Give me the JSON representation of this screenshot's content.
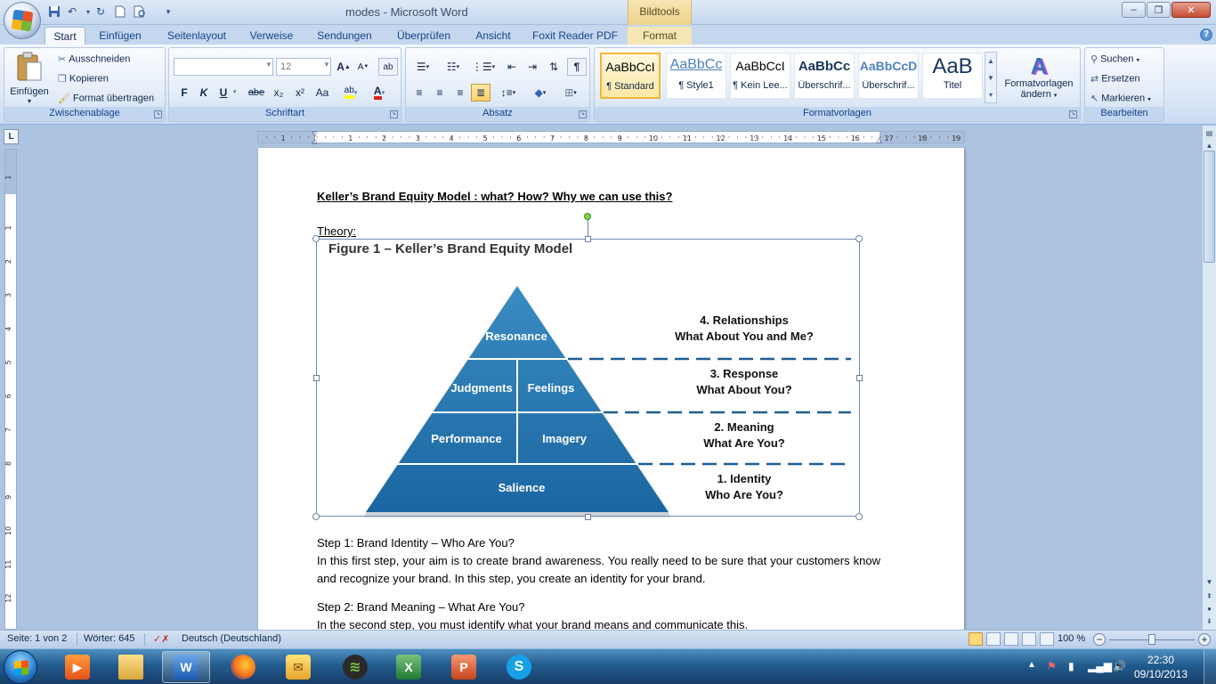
{
  "window": {
    "title": "modes - Microsoft Word",
    "context_tab": "Bildtools",
    "controls": {
      "minimize": "–",
      "maximize": "❐",
      "close": "✕"
    }
  },
  "quick_access": [
    "save-icon",
    "undo-icon",
    "redo-icon",
    "new-document-icon",
    "print-preview-icon"
  ],
  "tabs": [
    {
      "label": "Start",
      "active": true
    },
    {
      "label": "Einfügen"
    },
    {
      "label": "Seitenlayout"
    },
    {
      "label": "Verweise"
    },
    {
      "label": "Sendungen"
    },
    {
      "label": "Überprüfen"
    },
    {
      "label": "Ansicht"
    },
    {
      "label": "Foxit Reader PDF"
    },
    {
      "label": "Format"
    }
  ],
  "ribbon": {
    "clipboard": {
      "title": "Zwischenablage",
      "paste": "Einfügen",
      "cut": "Ausschneiden",
      "copy": "Kopieren",
      "format_painter": "Format übertragen"
    },
    "font": {
      "title": "Schriftart",
      "font_name": "",
      "font_size": "12",
      "bold": "F",
      "italic": "K",
      "underline": "U",
      "strike": "abe",
      "subscript": "x₂",
      "superscript": "x²",
      "case": "Aa"
    },
    "paragraph": {
      "title": "Absatz"
    },
    "styles": {
      "title": "Formatvorlagen",
      "items": [
        {
          "preview": "AaBbCcI",
          "name": "¶ Standard",
          "selected": true
        },
        {
          "preview": "AaBbCc",
          "name": "¶ Style1"
        },
        {
          "preview": "AaBbCcI",
          "name": "¶ Kein Lee..."
        },
        {
          "preview": "AaBbCc",
          "name": "Überschrif..."
        },
        {
          "preview": "AaBbCcD",
          "name": "Überschrif..."
        },
        {
          "preview": "AaB",
          "name": "Titel"
        }
      ],
      "change_styles_line1": "Formatvorlagen",
      "change_styles_line2": "ändern"
    },
    "editing": {
      "title": "Bearbeiten",
      "find": "Suchen",
      "replace": "Ersetzen",
      "select": "Markieren"
    }
  },
  "ruler": {
    "tab_selector": "L",
    "numbers": [
      "1",
      "1",
      "2",
      "3",
      "4",
      "5",
      "6",
      "7",
      "8",
      "9",
      "10",
      "11",
      "12",
      "13",
      "14",
      "15",
      "16",
      "17",
      "18",
      "19"
    ],
    "vertical_numbers": [
      "1",
      "1",
      "2",
      "3",
      "4",
      "5",
      "6",
      "7",
      "8",
      "9",
      "10",
      "11",
      "12"
    ]
  },
  "document": {
    "heading": "Keller’s Brand Equity Model : what? How? Why we can use this?",
    "theory_label": "Theory:",
    "figure": {
      "title": "Figure 1 – Keller’s Brand Equity Model",
      "blocks": [
        "Resonance",
        "Judgments",
        "Feelings",
        "Performance",
        "Imagery",
        "Salience"
      ],
      "steps": [
        {
          "line1": "4. Relationships",
          "line2": "What About You and Me?"
        },
        {
          "line1": "3. Response",
          "line2": "What About You?"
        },
        {
          "line1": "2. Meaning",
          "line2": "What Are You?"
        },
        {
          "line1": "1. Identity",
          "line2": "Who Are You?"
        }
      ],
      "colors": {
        "pyramid_light": "#2d7db3",
        "pyramid_dark": "#17609a",
        "dash": "#1e5e94"
      }
    },
    "step1_title": "Step 1: Brand Identity – Who Are You?",
    "step1_body": "In this first step, your aim is to create brand awareness. You really need to be sure that your customers know  and recognize your brand. In this step, you create an identity for your brand.",
    "step2_title": "Step 2: Brand Meaning – What Are You?",
    "step2_body": "In the second step, you must identify what your brand means and communicate this."
  },
  "status": {
    "page": "Seite: 1 von 2",
    "words": "Wörter: 645",
    "language": "Deutsch (Deutschland)",
    "zoom": "100 %"
  },
  "taskbar": {
    "apps": [
      "media-player-icon",
      "file-explorer-icon",
      "word-icon",
      "firefox-icon",
      "outlook-icon",
      "spotify-icon",
      "excel-icon",
      "powerpoint-icon",
      "skype-icon"
    ],
    "active_app": "word-icon",
    "time": "22:30",
    "date": "09/10/2013"
  }
}
